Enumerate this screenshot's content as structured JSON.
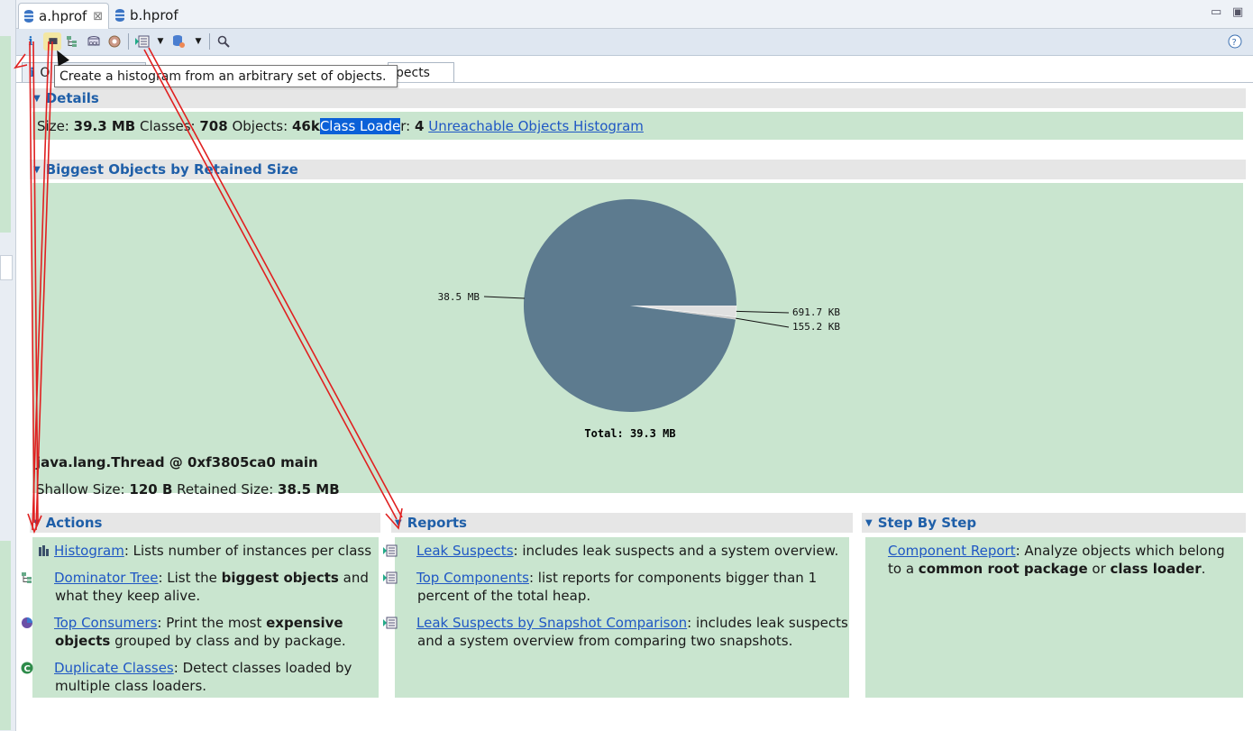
{
  "tabs": [
    {
      "label": "a.hprof",
      "active": true
    },
    {
      "label": "b.hprof",
      "active": false
    }
  ],
  "tab_close_glyph": "⊠",
  "window_controls": {
    "minimize": "▭",
    "maximize": "▣"
  },
  "toolbar": {
    "icons": [
      "info-icon",
      "histogram-icon",
      "dominator-tree-icon",
      "oql-icon",
      "heap-dump-overview-icon",
      "run-report-icon",
      "dropdown-arrow-icon",
      "query-browser-icon",
      "dropdown-arrow-icon",
      "search-icon",
      "help-icon"
    ],
    "info_glyph": "i",
    "histogram_glyph": "▮▮▮",
    "help_glyph": "?"
  },
  "tooltip": "Create a histogram from an arbitrary set of objects.",
  "subtabs": [
    {
      "icon": "i",
      "label": "O"
    },
    {
      "label": "pects"
    }
  ],
  "details": {
    "header": "Details",
    "size_label": "Size:",
    "size_value": "39.3 MB",
    "classes_label": "Classes:",
    "classes_value": "708",
    "objects_label": "Objects:",
    "objects_value": "46k",
    "class_loader_label": "Class Loade",
    "class_loader_rest": "r:",
    "class_loader_value": "4",
    "unreachable_link": "Unreachable Objects Histogram"
  },
  "biggest": {
    "header": "Biggest Objects by Retained Size",
    "object_name": "java.lang.Thread @ 0xf3805ca0 main",
    "shallow_label": "Shallow Size:",
    "shallow_value": "120 B",
    "retained_label": "Retained Size:",
    "retained_value": "38.5 MB"
  },
  "chart_data": {
    "type": "pie",
    "slices": [
      {
        "label": "38.5 MB",
        "value": 38.5,
        "color": "#5d7b8f"
      },
      {
        "label": "691.7 KB",
        "value": 0.6755,
        "color": "#e0e0e0"
      },
      {
        "label": "155.2 KB",
        "value": 0.1516,
        "color": "#c8c8c8"
      }
    ],
    "total_label": "Total: 39.3 MB"
  },
  "actions": {
    "header": "Actions",
    "items": [
      {
        "link": "Histogram",
        "pre": ": Lists number of instances per class",
        "bold": "",
        "post": "",
        "icon": "histogram-icon"
      },
      {
        "link": "Dominator Tree",
        "pre": ": List the ",
        "bold": "biggest objects",
        "post": " and what they keep alive.",
        "icon": "dominator-tree-icon"
      },
      {
        "link": "Top Consumers",
        "pre": ": Print the most ",
        "bold": "expensive objects",
        "post": " grouped by class and by package.",
        "icon": "top-consumers-icon"
      },
      {
        "link": "Duplicate Classes",
        "pre": ": Detect classes loaded by multiple class loaders.",
        "bold": "",
        "post": "",
        "icon": "duplicate-classes-icon"
      }
    ]
  },
  "reports": {
    "header": "Reports",
    "items": [
      {
        "link": "Leak Suspects",
        "text": ": includes leak suspects and a system overview."
      },
      {
        "link": "Top Components",
        "text": ": list reports for components bigger than 1 percent of the total heap."
      },
      {
        "link": "Leak Suspects by Snapshot Comparison",
        "text": ": includes leak suspects and a system overview from comparing two snapshots."
      }
    ]
  },
  "step_by_step": {
    "header": "Step By Step",
    "link": "Component Report",
    "text1": ": Analyze objects which belong to a ",
    "bold1": "common root package",
    "text2": " or ",
    "bold2": "class loader",
    "text3": "."
  },
  "twisty_glyph": "▼",
  "colors": {
    "accent": "#1f5fa8",
    "panel": "#c9e5cf",
    "arrow": "#e02020"
  }
}
